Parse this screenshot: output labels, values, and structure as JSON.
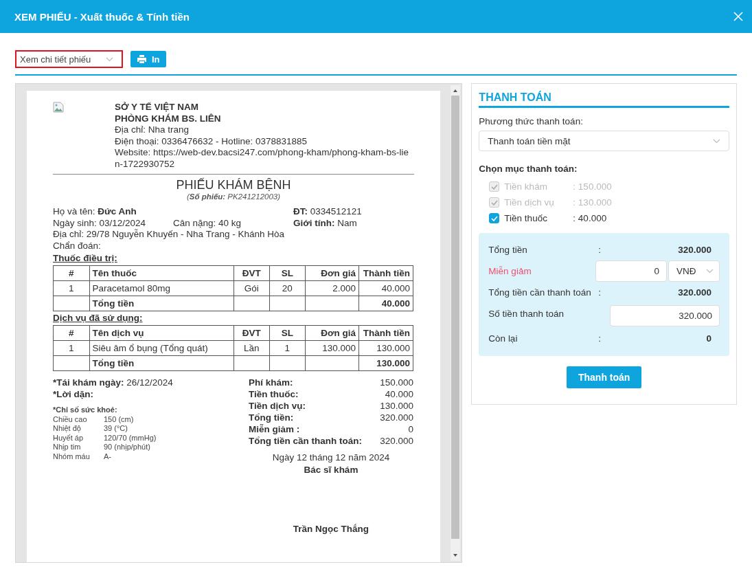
{
  "window": {
    "title": "XEM PHIẾU - Xuất thuốc & Tính tiền"
  },
  "toolbar": {
    "view_select": "Xem chi tiết phiếu",
    "print_button": "In"
  },
  "receipt": {
    "org": "SỞ Y TẾ VIỆT NAM",
    "clinic": "PHÒNG KHÁM BS. LIÊN",
    "address": "Địa chỉ: Nha trang",
    "phone": "Điện thoại: 0336476632 - Hotline: 0378831885",
    "website": "Website: https://web-dev.bacsi247.com/phong-kham/phong-kham-bs-lien-1722930752",
    "title": "PHIẾU KHÁM BỆNH",
    "number": "(**Số phiếu:** PK241212003)",
    "patient": {
      "name": "Họ và tên: **Đức Anh**",
      "phone": "**ĐT:** 0334512121",
      "dob": "Ngày sinh: 03/12/2024",
      "weight": "Cân nặng: 40 kg",
      "gender": "**Giới tính:** Nam",
      "address": "Địa chỉ: 29/78 Nguyễn Khuyến - Nha Trang - Khánh Hòa",
      "diagnosis": "Chẩn đoán:"
    },
    "tables": [
      {
        "heading": "Thuốc điều trị:",
        "columns": [
          "#",
          "Tên thuốc",
          "ĐVT",
          "SL",
          "Đơn giá",
          "Thành tiền"
        ],
        "rows": [
          [
            "1",
            "Paracetamol 80mg",
            "Gói",
            "20",
            "2.000",
            "40.000"
          ]
        ],
        "total_label": "Tổng tiền",
        "total": "40.000"
      },
      {
        "heading": "Dịch vụ đã sử dụng:",
        "columns": [
          "#",
          "Tên dịch vụ",
          "ĐVT",
          "SL",
          "Đơn giá",
          "Thành tiền"
        ],
        "rows": [
          [
            "1",
            "Siêu âm ổ bụng (Tổng quát)",
            "Lần",
            "1",
            "130.000",
            "130.000"
          ]
        ],
        "total_label": "Tổng tiền",
        "total": "130.000"
      }
    ],
    "revisit_label": "*Tái khám ngày:",
    "revisit_date": "26/12/2024",
    "advice_label": "*Lời dặn:",
    "health": {
      "heading": "*Chỉ số sức khoẻ:",
      "rows": [
        [
          "Chiều cao",
          "150 (cm)"
        ],
        [
          "Nhiệt độ",
          "39 (°C)"
        ],
        [
          "Huyết áp",
          "120/70 (mmHg)"
        ],
        [
          "Nhịp tim",
          "90 (nhịp/phút)"
        ],
        [
          "Nhóm máu",
          "A-"
        ]
      ]
    },
    "summary": [
      {
        "label": "Phí khám:",
        "value": "150.000"
      },
      {
        "label": "Tiền thuốc:",
        "value": "40.000"
      },
      {
        "label": "Tiền dịch vụ:",
        "value": "130.000"
      },
      {
        "label": "Tổng tiền:",
        "value": "320.000"
      },
      {
        "label": "Miễn giảm :",
        "value": "0"
      },
      {
        "label": "Tổng tiền cần thanh toán:",
        "value": "320.000"
      }
    ],
    "date": "Ngày 12 tháng 12 năm 2024",
    "doctor_title": "Bác sĩ khám",
    "doctor_name": "Trần Ngọc Thắng"
  },
  "payment": {
    "title": "THANH TOÁN",
    "method_label": "Phương thức thanh toán:",
    "method_value": "Thanh toán tiền mặt",
    "items_label": "Chọn mục thanh toán:",
    "items": [
      {
        "label": "Tiền khám",
        "value": ": 150.000",
        "checked": true,
        "disabled": true
      },
      {
        "label": "Tiền dịch vụ",
        "value": ": 130.000",
        "checked": true,
        "disabled": true
      },
      {
        "label": "Tiền thuốc",
        "value": ": 40.000",
        "checked": true,
        "disabled": false
      }
    ],
    "rows": [
      {
        "kind": "text",
        "label": "Tổng tiền",
        "colon": ":",
        "value": "320.000"
      },
      {
        "kind": "discount",
        "label": "Miễn giảm",
        "value": "0",
        "currency": "VNĐ"
      },
      {
        "kind": "text",
        "label": "Tổng tiền cần thanh toán",
        "colon": ":",
        "value": "320.000"
      },
      {
        "kind": "input",
        "label": "Số tiền thanh toán",
        "value": "320.000"
      },
      {
        "kind": "text",
        "label": "Còn lại",
        "colon": ":",
        "value": "0"
      }
    ],
    "button": "Thanh toán"
  }
}
